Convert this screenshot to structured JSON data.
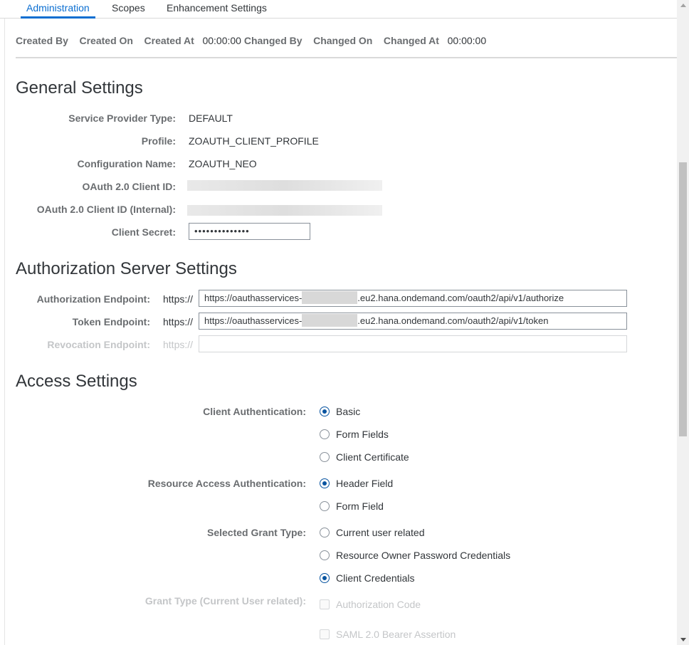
{
  "tabs": [
    {
      "label": "Administration",
      "active": true
    },
    {
      "label": "Scopes",
      "active": false
    },
    {
      "label": "Enhancement Settings",
      "active": false
    }
  ],
  "admin_bar": {
    "created_by_label": "Created By",
    "created_on_label": "Created On",
    "created_at_label": "Created At",
    "created_at_value": "00:00:00",
    "changed_by_label": "Changed By",
    "changed_on_label": "Changed On",
    "changed_at_label": "Changed At",
    "changed_at_value": "00:00:00"
  },
  "general": {
    "title": "General Settings",
    "service_provider_type_label": "Service Provider Type:",
    "service_provider_type_value": "DEFAULT",
    "profile_label": "Profile:",
    "profile_value": "ZOAUTH_CLIENT_PROFILE",
    "configuration_name_label": "Configuration Name:",
    "configuration_name_value": "ZOAUTH_NEO",
    "client_id_label": "OAuth 2.0 Client ID:",
    "client_id_internal_label": "OAuth 2.0 Client ID (Internal):",
    "client_secret_label": "Client Secret:",
    "client_secret_value": "••••••••••••••"
  },
  "auth_server": {
    "title": "Authorization Server Settings",
    "authorization_endpoint_label": "Authorization Endpoint:",
    "authorization_prefix": "https://",
    "authorization_url_start": "https://oauthasservices-",
    "authorization_url_end": ".eu2.hana.ondemand.com/oauth2/api/v1/authorize",
    "token_endpoint_label": "Token Endpoint:",
    "token_prefix": "https://",
    "token_url_start": "https://oauthasservices-",
    "token_url_end": ".eu2.hana.ondemand.com/oauth2/api/v1/token",
    "revocation_endpoint_label": "Revocation Endpoint:",
    "revocation_prefix": "https://"
  },
  "access": {
    "title": "Access Settings",
    "client_authentication_label": "Client Authentication:",
    "client_authentication_options": [
      "Basic",
      "Form Fields",
      "Client Certificate"
    ],
    "client_authentication_selected": "Basic",
    "resource_access_label": "Resource Access Authentication:",
    "resource_access_options": [
      "Header Field",
      "Form Field"
    ],
    "resource_access_selected": "Header Field",
    "grant_type_label": "Selected Grant Type:",
    "grant_type_options": [
      "Current user related",
      "Resource Owner Password Credentials",
      "Client Credentials"
    ],
    "grant_type_selected": "Client Credentials",
    "grant_type_current_user_label": "Grant Type (Current User related):",
    "grant_type_current_user_options": [
      "Authorization Code",
      "SAML 2.0 Bearer Assertion"
    ]
  }
}
